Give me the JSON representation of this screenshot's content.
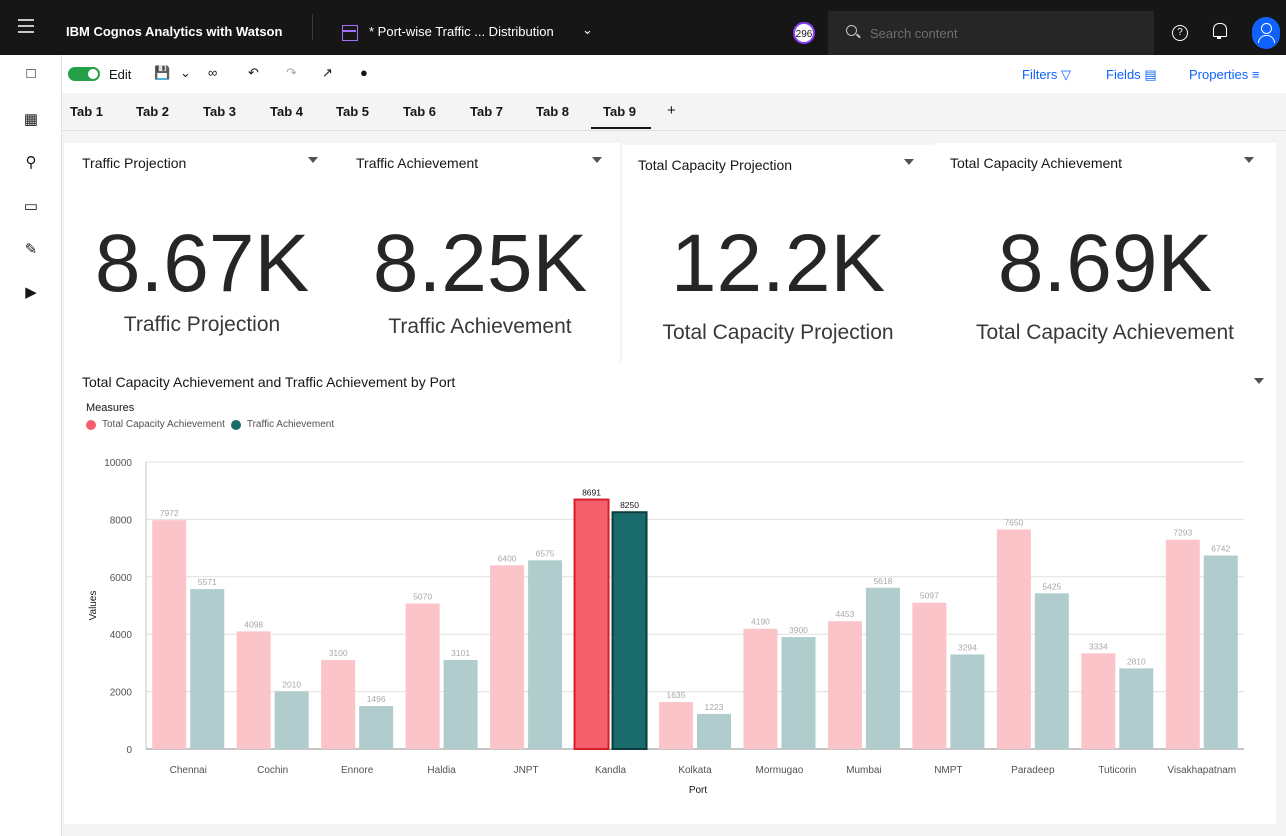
{
  "app": {
    "title": "IBM Cognos Analytics with Watson",
    "doc_title": "* Port-wise Traffic ... Distribution",
    "badge": "296",
    "search_placeholder": "Search content"
  },
  "toolbar": {
    "edit_label": "Edit",
    "filters_label": "Filters",
    "fields_label": "Fields",
    "properties_label": "Properties"
  },
  "tabs": [
    "Tab 1",
    "Tab 2",
    "Tab 3",
    "Tab 4",
    "Tab 5",
    "Tab 6",
    "Tab 7",
    "Tab 8",
    "Tab 9"
  ],
  "active_tab": "Tab 9",
  "kpis": [
    {
      "title": "Traffic Projection",
      "value": "8.67K",
      "subtitle": "Traffic Projection"
    },
    {
      "title": "Traffic Achievement",
      "value": "8.25K",
      "subtitle": "Traffic Achievement"
    },
    {
      "title": "Total Capacity Projection",
      "value": "12.2K",
      "subtitle": "Total Capacity Projection"
    },
    {
      "title": "Total Capacity Achievement",
      "value": "8.69K",
      "subtitle": "Total Capacity Achievement"
    }
  ],
  "chart": {
    "title": "Total Capacity Achievement and Traffic Achievement by Port",
    "legend_title": "Measures",
    "colors": {
      "capacity": "#f4606c",
      "capacity_faded": "#fbc4c8",
      "traffic": "#1a6b6b",
      "traffic_faded": "#b0cccc"
    }
  },
  "chart_data": {
    "type": "bar",
    "title": "Total Capacity Achievement and Traffic Achievement by Port",
    "xlabel": "Port",
    "ylabel": "Values",
    "ylim": [
      0,
      10000
    ],
    "yticks": [
      0,
      2000,
      4000,
      6000,
      8000,
      10000
    ],
    "categories": [
      "Chennai",
      "Cochin",
      "Ennore",
      "Haldia",
      "JNPT",
      "Kandla",
      "Kolkata",
      "Mormugao",
      "Mumbai",
      "NMPT",
      "Paradeep",
      "Tuticorin",
      "Visakhapatnam"
    ],
    "highlighted": "Kandla",
    "series": [
      {
        "name": "Total Capacity Achievement",
        "values": [
          7972,
          4098,
          3100,
          5070,
          6400,
          8691,
          1635,
          4190,
          4453,
          5097,
          7650,
          3334,
          7293
        ]
      },
      {
        "name": "Traffic Achievement",
        "values": [
          5571,
          2010,
          1496,
          3101,
          6575,
          8250,
          1223,
          3900,
          5618,
          3294,
          5425,
          2810,
          6742
        ]
      }
    ],
    "grid": true,
    "legend": "top-left"
  }
}
